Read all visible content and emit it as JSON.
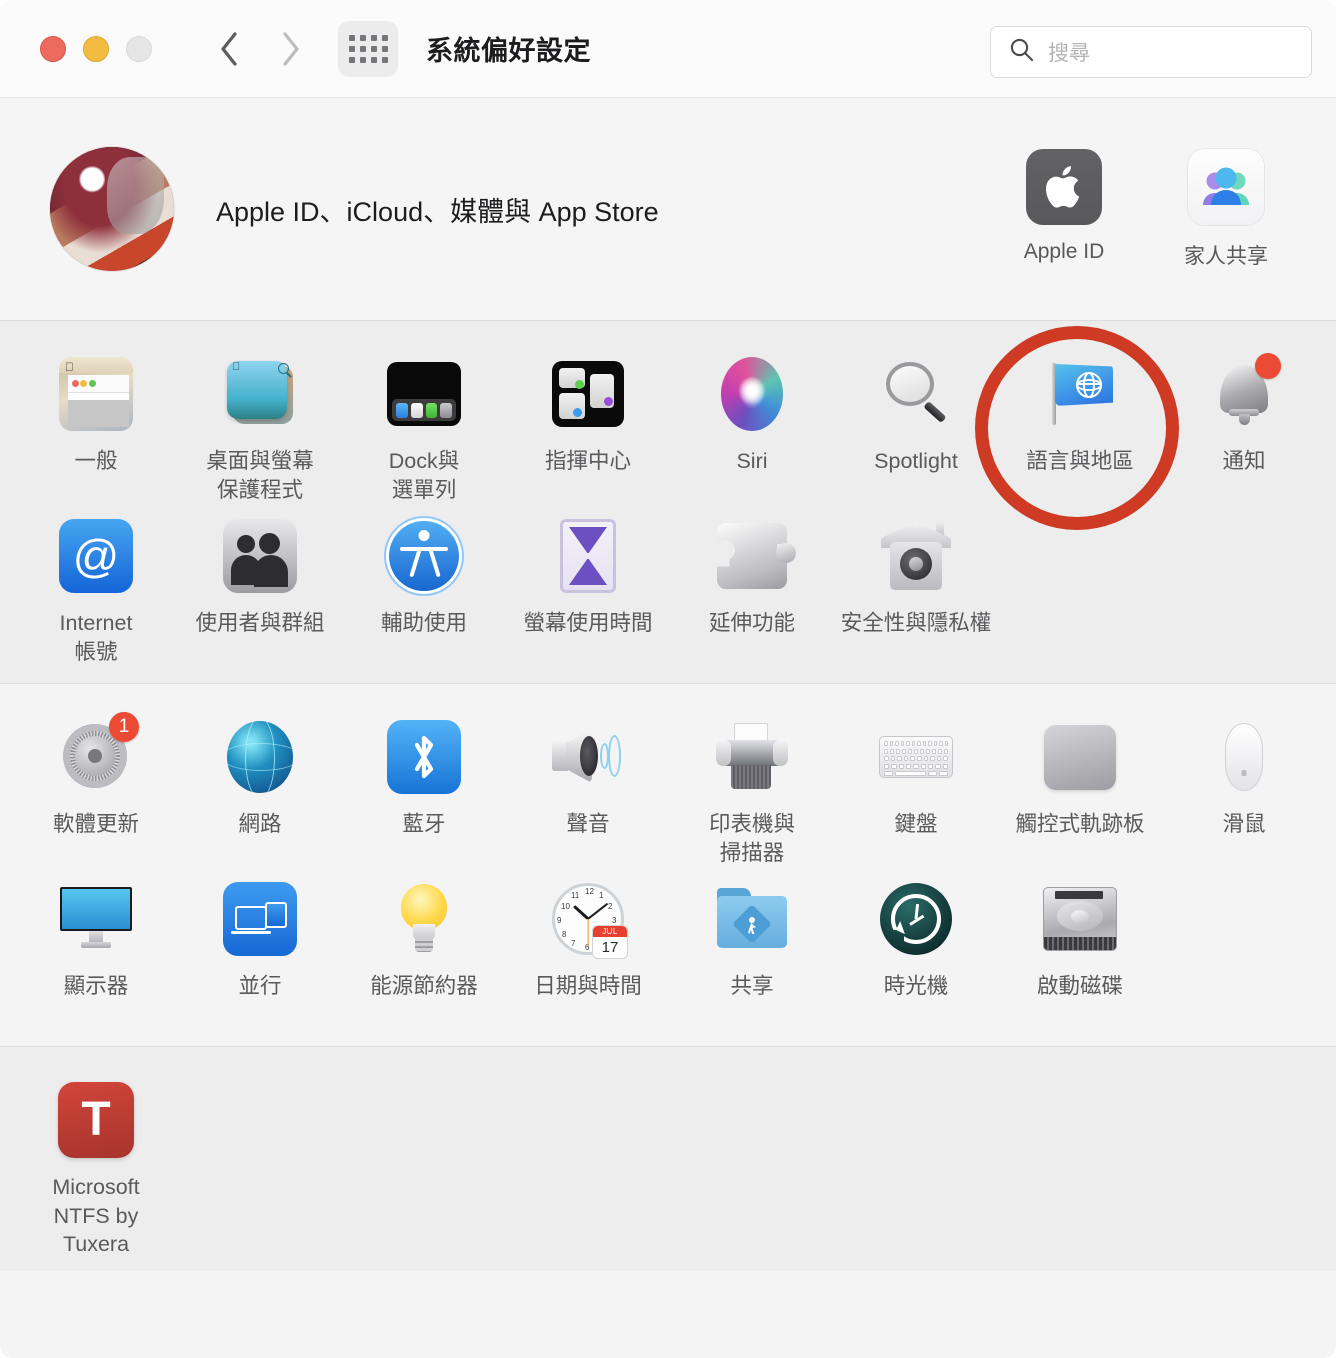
{
  "window": {
    "title": "系統偏好設定",
    "traffic_lights": [
      "close",
      "minimize",
      "zoom"
    ],
    "back_label": "上一頁",
    "forward_label": "下一頁",
    "grid_label": "顯示全部"
  },
  "search": {
    "placeholder": "搜尋",
    "value": ""
  },
  "account": {
    "label": "Apple ID、iCloud、媒體與 App Store",
    "avatar_name": "user-avatar",
    "tiles": [
      {
        "label": "Apple ID",
        "icon": "apple-logo-icon"
      },
      {
        "label": "家人共享",
        "icon": "family-sharing-icon"
      }
    ]
  },
  "sections": [
    {
      "name": "personal",
      "rows": [
        [
          {
            "label": "一般",
            "icon": "general-icon",
            "badge": ""
          },
          {
            "label": "桌面與螢幕\n保護程式",
            "icon": "desktop-screensaver-icon",
            "badge": ""
          },
          {
            "label": "Dock與\n選單列",
            "icon": "dock-menubar-icon",
            "badge": ""
          },
          {
            "label": "指揮中心",
            "icon": "mission-control-icon",
            "badge": ""
          },
          {
            "label": "Siri",
            "icon": "siri-icon",
            "badge": ""
          },
          {
            "label": "Spotlight",
            "icon": "spotlight-icon",
            "badge": ""
          },
          {
            "label": "語言與地區",
            "icon": "language-region-icon",
            "badge": "",
            "highlighted": true
          },
          {
            "label": "通知",
            "icon": "notifications-icon",
            "badge": "dot"
          }
        ],
        [
          {
            "label": "Internet\n帳號",
            "icon": "internet-accounts-icon",
            "badge": ""
          },
          {
            "label": "使用者與群組",
            "icon": "users-groups-icon",
            "badge": ""
          },
          {
            "label": "輔助使用",
            "icon": "accessibility-icon",
            "badge": ""
          },
          {
            "label": "螢幕使用時間",
            "icon": "screen-time-icon",
            "badge": ""
          },
          {
            "label": "延伸功能",
            "icon": "extensions-icon",
            "badge": ""
          },
          {
            "label": "安全性與隱私權",
            "icon": "security-privacy-icon",
            "badge": ""
          }
        ]
      ]
    },
    {
      "name": "hardware",
      "rows": [
        [
          {
            "label": "軟體更新",
            "icon": "software-update-icon",
            "badge": "1"
          },
          {
            "label": "網路",
            "icon": "network-icon",
            "badge": ""
          },
          {
            "label": "藍牙",
            "icon": "bluetooth-icon",
            "badge": ""
          },
          {
            "label": "聲音",
            "icon": "sound-icon",
            "badge": ""
          },
          {
            "label": "印表機與\n掃描器",
            "icon": "printers-scanners-icon",
            "badge": ""
          },
          {
            "label": "鍵盤",
            "icon": "keyboard-icon",
            "badge": ""
          },
          {
            "label": "觸控式軌跡板",
            "icon": "trackpad-icon",
            "badge": ""
          },
          {
            "label": "滑鼠",
            "icon": "mouse-icon",
            "badge": ""
          }
        ],
        [
          {
            "label": "顯示器",
            "icon": "displays-icon",
            "badge": ""
          },
          {
            "label": "並行",
            "icon": "sidecar-icon",
            "badge": ""
          },
          {
            "label": "能源節約器",
            "icon": "energy-saver-icon",
            "badge": ""
          },
          {
            "label": "日期與時間",
            "icon": "date-time-icon",
            "badge": ""
          },
          {
            "label": "共享",
            "icon": "sharing-icon",
            "badge": ""
          },
          {
            "label": "時光機",
            "icon": "time-machine-icon",
            "badge": ""
          },
          {
            "label": "啟動磁碟",
            "icon": "startup-disk-icon",
            "badge": ""
          }
        ]
      ]
    },
    {
      "name": "third-party",
      "rows": [
        [
          {
            "label": "Microsoft\nNTFS by Tuxera",
            "icon": "tuxera-ntfs-icon",
            "badge": ""
          }
        ]
      ]
    }
  ],
  "date_time_icon": {
    "month": "JUL",
    "day": "17",
    "numerals": [
      "12",
      "1",
      "2",
      "3",
      "4",
      "5",
      "6",
      "7",
      "8",
      "9",
      "10",
      "11"
    ]
  },
  "annotation": {
    "shape": "circle",
    "color": "#ce3a23",
    "target": "語言與地區"
  },
  "colors": {
    "accent_red": "#ce3a23",
    "badge_red": "#eb4a35",
    "titlebar_bg": "#fbfbfb",
    "pane_light": "#f4f4f4",
    "pane_alt": "#ededed",
    "caption_text": "#5a5a5d"
  }
}
